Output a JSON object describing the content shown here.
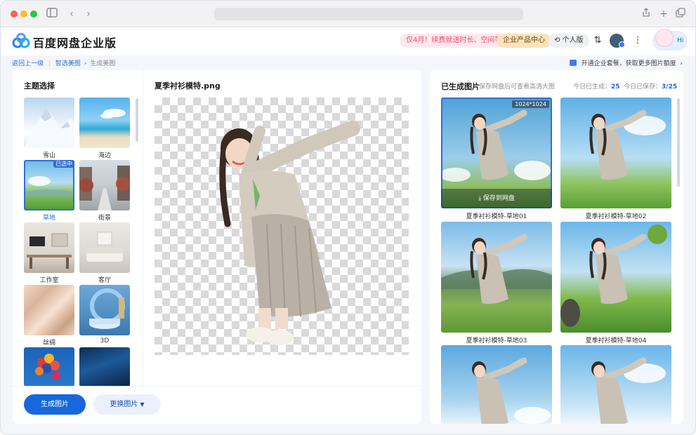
{
  "header": {
    "brand": "百度网盘企业版",
    "promo": "仅4月！续费就送时长、空间等",
    "enterprise_center": "企业产品中心",
    "personal": "个人版",
    "hi": "Hi"
  },
  "breadcrumb": {
    "back": "返回上一级",
    "parent": "智选美图",
    "current": "生成美图"
  },
  "upsell": "开通企业套餐，获取更多图片额度",
  "left": {
    "theme_title": "主题选择",
    "file_name": "夏季衬衫模特.png",
    "selected_badge": "已选中",
    "themes": [
      {
        "label": "雪山"
      },
      {
        "label": "海边"
      },
      {
        "label": "草地"
      },
      {
        "label": "街景"
      },
      {
        "label": "工作室"
      },
      {
        "label": "客厅"
      },
      {
        "label": "丝绸"
      },
      {
        "label": "3D"
      },
      {
        "label": ""
      },
      {
        "label": ""
      }
    ],
    "generate_button": "生成图片",
    "change_button": "更换图片"
  },
  "right": {
    "title": "已生成图片",
    "subtitle": "保存网盘后可查看高清大图",
    "today_generated_label": "今日已生成：",
    "today_generated_value": "25",
    "today_saved_label": "今日已保存：",
    "today_saved_value": "3/25",
    "size_badge": "1024*1024",
    "save_label": "保存到网盘",
    "results": [
      {
        "label": "夏季衬衫模特-草地01"
      },
      {
        "label": "夏季衬衫模特-草地02"
      },
      {
        "label": "夏季衬衫模特-草地03"
      },
      {
        "label": "夏季衬衫模特-草地04"
      },
      {
        "label": ""
      },
      {
        "label": ""
      }
    ]
  },
  "colors": {
    "accent": "#1668dc",
    "promo_text": "#f2466b"
  }
}
